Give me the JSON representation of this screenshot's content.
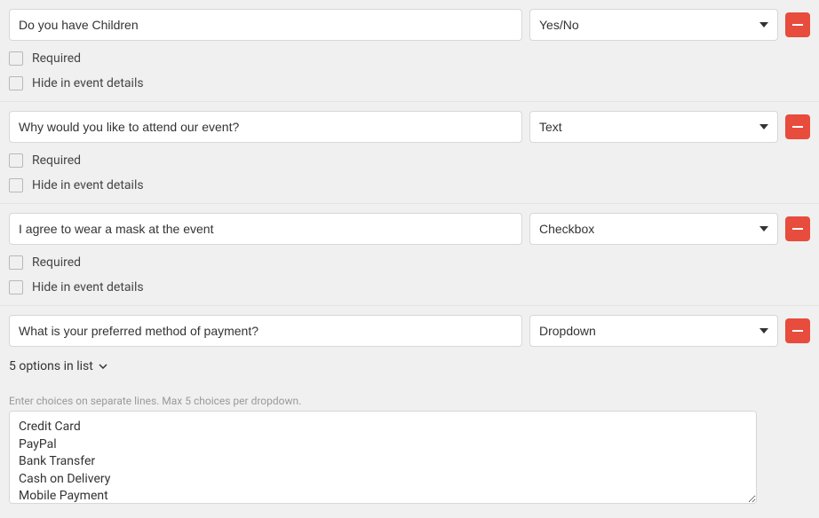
{
  "labels": {
    "required": "Required",
    "hide": "Hide in event details"
  },
  "questions": [
    {
      "text": "Do you have Children",
      "type": "Yes/No",
      "hasOptions": false
    },
    {
      "text": "Why would you like to attend our event?",
      "type": "Text",
      "hasOptions": false
    },
    {
      "text": "I agree to wear a mask at the event",
      "type": "Checkbox",
      "hasOptions": false
    },
    {
      "text": "What is your preferred method of payment?",
      "type": "Dropdown",
      "hasOptions": true,
      "optionsSummary": "5 options in list",
      "helpText": "Enter choices on separate lines. Max 5 choices per dropdown.",
      "choicesText": "Credit Card\nPayPal\nBank Transfer\nCash on Delivery\nMobile Payment"
    }
  ]
}
